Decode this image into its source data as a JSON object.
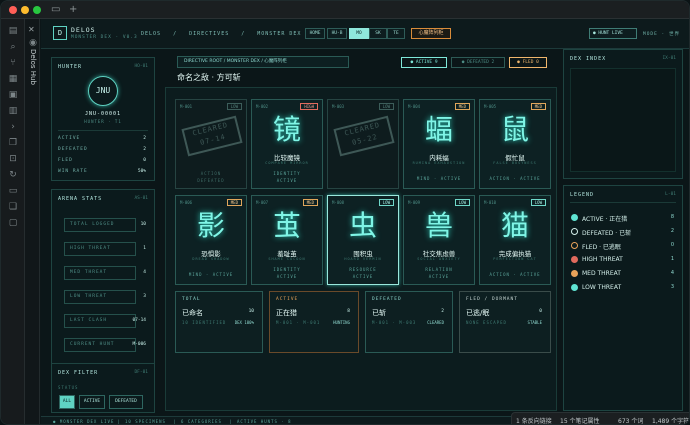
{
  "window": {
    "new_tab": "+",
    "tab_label": "Delos Hub"
  },
  "topbar": {
    "brand": "DELOS",
    "brand_sub": "MONSTER DEX · V0.3",
    "logo": "D",
    "crumbs": [
      "DELOS",
      "/",
      "DIRECTIVES",
      "/",
      "MONSTER DEX"
    ],
    "segments": [
      {
        "label": "HOME",
        "active": false
      },
      {
        "label": "HU-B",
        "active": false
      },
      {
        "label": "MO",
        "active": true
      },
      {
        "label": "SK",
        "active": false
      },
      {
        "label": "TE",
        "active": false
      }
    ],
    "heart_button": "心魔阵列柜",
    "hunt_live": "● HUNT LIVE",
    "mode_label": "MODE · 世界"
  },
  "hunter": {
    "header": "HUNTER",
    "code": "HO-01",
    "avatar": "JNU",
    "id": "JNU-00001",
    "rank": "HUNTER · T1",
    "rows": [
      {
        "label": "ACTIVE",
        "value": "2"
      },
      {
        "label": "DEFEATED",
        "value": "2"
      },
      {
        "label": "FLED",
        "value": "0"
      },
      {
        "label": "WIN RATE",
        "value": "50%"
      }
    ]
  },
  "arena": {
    "header": "ARENA STATS",
    "code": "AS-01",
    "stats": [
      {
        "label": "TOTAL LOGGED",
        "value": "10"
      },
      {
        "label": "HIGH THREAT",
        "value": "1"
      },
      {
        "label": "MED THREAT",
        "value": "4"
      },
      {
        "label": "LOW THREAT",
        "value": "3"
      },
      {
        "label": "LAST CLASH",
        "value": "07-14"
      },
      {
        "label": "CURRENT HUNT",
        "value": "M-006"
      }
    ]
  },
  "filter": {
    "header": "DEX FILTER",
    "code": "DF-01",
    "status_label": "STATUS",
    "buttons": [
      {
        "label": "ALL",
        "active": true
      },
      {
        "label": "ACTIVE",
        "active": false
      },
      {
        "label": "DEFEATED",
        "active": false
      }
    ]
  },
  "main": {
    "crumbs": [
      "DIRECTIVE ROOT",
      "/",
      "MONSTER DEX",
      "/",
      "心魔阵列柜"
    ],
    "title": "命名之敌 · 方可斩",
    "pills": [
      {
        "label": "● ACTIVE 9",
        "color": "#7fe8da"
      },
      {
        "label": "● DEFEATED 2",
        "color": "#4d8d85"
      },
      {
        "label": "● FLED 0",
        "color": "#f0b66c"
      }
    ],
    "cards": [
      {
        "id": "M-001",
        "badge": "LOW",
        "tier": "dim",
        "glyph": "",
        "name": "",
        "sub": "",
        "s1": "ACTION",
        "s2": "DEFEATED",
        "stamp": "CLEARED 07-14",
        "cleared": true
      },
      {
        "id": "M-002",
        "badge": "HIGH",
        "tier": "high",
        "glyph": "镜",
        "name": "比较魔镜",
        "sub": "COMPARE MIRROR",
        "s1": "IDENTITY",
        "s2": "ACTIVE"
      },
      {
        "id": "M-003",
        "badge": "LOW",
        "tier": "dim",
        "glyph": "",
        "name": "",
        "sub": "",
        "s1": "",
        "s2": "",
        "stamp": "CLEARED 05-22",
        "cleared": true
      },
      {
        "id": "M-004",
        "badge": "MED",
        "tier": "med",
        "glyph": "蝠",
        "name": "内耗蝠",
        "sub": "RUMINA EXHAUSTION",
        "s1": "MIND",
        "s2": "· ACTIVE"
      },
      {
        "id": "M-005",
        "badge": "MED",
        "tier": "med",
        "glyph": "鼠",
        "name": "假忙鼠",
        "sub": "FALSE BUSYNESS",
        "s1": "ACTION · ACTIVE",
        "s2": ""
      },
      {
        "id": "M-006",
        "badge": "MED",
        "tier": "med",
        "glyph": "影",
        "name": "恐惧影",
        "sub": "DREAD SHADOW",
        "s1": "MIND · ACTIVE",
        "s2": ""
      },
      {
        "id": "M-007",
        "badge": "MED",
        "tier": "med",
        "glyph": "茧",
        "name": "羞耻茧",
        "sub": "SHAME COCOON",
        "s1": "IDENTITY",
        "s2": "ACTIVE"
      },
      {
        "id": "M-008",
        "badge": "LOW",
        "tier": "low",
        "glyph": "虫",
        "name": "囤积虫",
        "sub": "HOARD VERMIN",
        "s1": "RESOURCE",
        "s2": "ACTIVE",
        "selected": true
      },
      {
        "id": "M-009",
        "badge": "LOW",
        "tier": "low",
        "glyph": "兽",
        "name": "社交焦虑兽",
        "sub": "SOCIAL ANXIETY",
        "s1": "RELATION",
        "s2": "ACTIVE"
      },
      {
        "id": "M-010",
        "badge": "LOW",
        "tier": "low",
        "glyph": "猫",
        "name": "完成偏执猫",
        "sub": "PERFECTION CAT",
        "s1": "ACTION · ACTIVE",
        "s2": ""
      }
    ],
    "summary": [
      {
        "title": "TOTAL",
        "big": "已命名",
        "big2": "10",
        "sm": "10 IDENTIFIED",
        "sm2": "DEX 100%",
        "color": "#8fd8cf",
        "border": "#2a5a55"
      },
      {
        "title": "ACTIVE",
        "big": "正在猎",
        "big2": "8",
        "sm": "M-001 · M-001",
        "sm2": "HUNTING",
        "color": "#e9a35a",
        "border": "#6a4a2a"
      },
      {
        "title": "DEFEATED",
        "big": "已斩",
        "big2": "2",
        "sm": "M-001 · M-003",
        "sm2": "CLEARED",
        "color": "#8fd8cf",
        "border": "#2a5a55"
      },
      {
        "title": "FLED / DORMANT",
        "big": "已逃/眠",
        "big2": "0",
        "sm": "NONE ESCAPED",
        "sm2": "STABLE",
        "color": "#c9d8d5",
        "border": "#3a4c4a"
      }
    ]
  },
  "dex_index": {
    "header": "DEX INDEX",
    "code": "IX-01"
  },
  "legend": {
    "header": "LEGEND",
    "code": "L-01",
    "items": [
      {
        "label": "ACTIVE · 正在猎",
        "count": "8",
        "color": "#5fe3d2",
        "ring": false
      },
      {
        "label": "DEFEATED · 已斩",
        "count": "2",
        "color": "#0b1a1c",
        "ring": true
      },
      {
        "label": "FLED · 已逃眠",
        "count": "0",
        "color": "#0b1a1c",
        "ring": true
      },
      {
        "label": "HIGH THREAT",
        "count": "1",
        "color": "#e06a5d",
        "ring": false
      },
      {
        "label": "MED THREAT",
        "count": "4",
        "color": "#e9a35a",
        "ring": false
      },
      {
        "label": "LOW THREAT",
        "count": "3",
        "color": "#5fe3d2",
        "ring": false
      }
    ]
  },
  "footer": [
    "● MONSTER DEX LIVE",
    "|",
    "10 SPECIMENS",
    "|",
    "6 CATEGORIES",
    "|",
    "ACTIVE HUNTS · 8"
  ],
  "status": {
    "backlinks": "1 条反向链接",
    "props": "15 个笔记属性",
    "words": "673 个词",
    "chars": "1,489 个字符"
  }
}
